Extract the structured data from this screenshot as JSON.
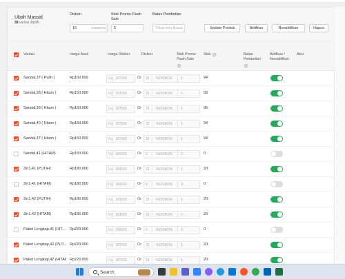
{
  "mass_edit": {
    "title": "Ubah Massal",
    "selected_count": "39",
    "selected_suffix": "variasi dipilih",
    "discount_label": "Diskon",
    "discount_value": "15",
    "discount_suffix": "%DISKON",
    "flash_stock_label": "Stok Promo Flash Sale",
    "flash_stock_value": "5",
    "purchase_limit_label": "Batas Pembelian",
    "purchase_limit_placeholder": "Tidak Ada Batas",
    "update_button": "Update Produk",
    "activate_button": "Aktifkan",
    "deactivate_button": "Nonaktifkan",
    "delete_button": "Hapus"
  },
  "table": {
    "headers": {
      "variant": "Variasi",
      "original_price": "Harga Awal",
      "discount_price": "Harga Diskon",
      "discount": "Diskon",
      "flash_stock": "Stok Promo Flash Sale",
      "stock": "Stok",
      "purchase_limit": "Batas Pembelian",
      "active": "Aktifkan / Nonaktifkan",
      "action": "Aksi"
    },
    "currency_prefix": "Rp",
    "or_label": "Or",
    "discount_suffix": "%DISKON",
    "rows": [
      {
        "checked": true,
        "variant": "Sandal,37 ( Putih )",
        "price": "Rp150.000",
        "disc_price": "127500",
        "disc": "15",
        "flash": "5",
        "stock": "94",
        "active": true
      },
      {
        "checked": true,
        "variant": "Sandal,38 ( Hitam )",
        "price": "Rp150.000",
        "disc_price": "127500",
        "disc": "15",
        "flash": "5",
        "stock": "93",
        "active": true
      },
      {
        "checked": true,
        "variant": "Sandal,39 ( Hitam )",
        "price": "Rp150.000",
        "disc_price": "127500",
        "disc": "15",
        "flash": "5",
        "stock": "95",
        "active": true
      },
      {
        "checked": true,
        "variant": "Sandal,40 ( Hitam )",
        "price": "Rp150.000",
        "disc_price": "127500",
        "disc": "15",
        "flash": "5",
        "stock": "94",
        "active": true
      },
      {
        "checked": true,
        "variant": "Sandal,37 ( Hitam )",
        "price": "Rp150.000",
        "disc_price": "127500",
        "disc": "15",
        "flash": "5",
        "stock": "94",
        "active": true
      },
      {
        "checked": false,
        "variant": "Sandal,41 (HITAM)",
        "price": "Rp150.000",
        "disc_price": "150000",
        "disc": "0",
        "flash": "0",
        "stock": "0",
        "active": false
      },
      {
        "checked": true,
        "variant": "2in1,41 (PUTIH)",
        "price": "Rp180.000",
        "disc_price": "153000",
        "disc": "15",
        "flash": "5",
        "stock": "20",
        "active": true
      },
      {
        "checked": false,
        "variant": "2in1,41 (HITAM)",
        "price": "Rp180.000",
        "disc_price": "180000",
        "disc": "0",
        "flash": "0",
        "stock": "0",
        "active": false
      },
      {
        "checked": true,
        "variant": "2in1,42 (PUTIH)",
        "price": "Rp180.000",
        "disc_price": "153000",
        "disc": "15",
        "flash": "5",
        "stock": "20",
        "active": true
      },
      {
        "checked": true,
        "variant": "2in1,42 (HITAM)",
        "price": "Rp180.000",
        "disc_price": "153000",
        "disc": "15",
        "flash": "5",
        "stock": "20",
        "active": true
      },
      {
        "checked": false,
        "variant": "Paket Lengkap,41 (HIT...",
        "price": "Rp220.000",
        "disc_price": "220000",
        "disc": "0",
        "flash": "0",
        "stock": "0",
        "active": false
      },
      {
        "checked": true,
        "variant": "Paket Lengkap,42 (PUT...",
        "price": "Rp220.000",
        "disc_price": "187000",
        "disc": "15",
        "flash": "5",
        "stock": "20",
        "active": true
      },
      {
        "checked": true,
        "variant": "Paket Lengkap,42 (HITAM)",
        "price": "Rp220.000",
        "disc_price": "187000",
        "disc": "15",
        "flash": "5",
        "stock": "20",
        "active": true
      }
    ]
  },
  "taskbar": {
    "search_label": "Search",
    "icons": [
      "windows-start-icon",
      "search-icon",
      "task-view-icon",
      "file-explorer-icon",
      "teams-chat-icon",
      "widgets-icon",
      "copilot-icon",
      "edge-icon",
      "store-icon",
      "brave-icon",
      "chrome-icon",
      "onedrive-icon",
      "excel-icon"
    ]
  },
  "colors": {
    "accent": "#ee4d2d",
    "toggle_on": "#26aa5a",
    "toggle_off": "#dcdcdc"
  }
}
